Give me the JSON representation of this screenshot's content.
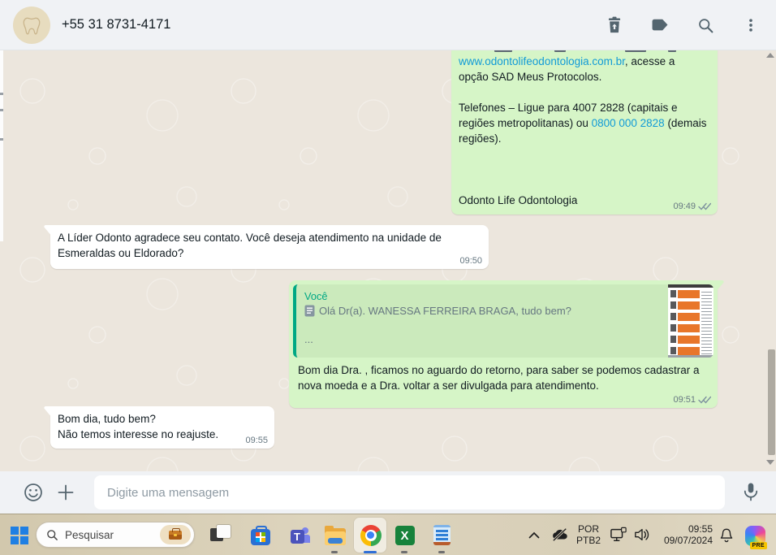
{
  "header": {
    "title": "+55 31 8731-4171"
  },
  "chat": {
    "messages": [
      {
        "direction": "out",
        "time": "09:49",
        "status": "delivered",
        "segments": [
          {
            "text": "www.odontolifeodontologia.com.br",
            "link": true
          },
          {
            "text": ", acesse a\nopção SAD Meus Protocolos.\n\nTelefones – Ligue para 4007 2828 (capitais e\nregiões metropolitanas) ou ",
            "link": false
          },
          {
            "text": "0800 000 2828",
            "link": true
          },
          {
            "text": " (demais\nregiões).\n\n\n\nOdonto Life Odontologia",
            "link": false
          }
        ]
      },
      {
        "direction": "in",
        "time": "09:50",
        "text": "A Líder Odonto agradece seu contato. Você deseja atendimento na unidade de\nEsmeraldas ou Eldorado?"
      },
      {
        "direction": "out",
        "time": "09:51",
        "status": "delivered",
        "quote": {
          "author": "Você",
          "text": "Olá Dr(a). WANESSA FERREIRA BRAGA, tudo bem?",
          "more": "...",
          "attachment": "document-thumbnail"
        },
        "text": "Bom dia Dra. , ficamos no aguardo do retorno, para saber se podemos cadastrar a\nnova moeda e a Dra. voltar a ser divulgada para atendimento."
      },
      {
        "direction": "in",
        "time": "09:55",
        "text": "Bom dia, tudo bem?\nNão temos interesse no reajuste."
      }
    ]
  },
  "composer": {
    "placeholder": "Digite uma mensagem"
  },
  "taskbar": {
    "search_placeholder": "Pesquisar",
    "teams_letter": "T",
    "tray": {
      "language_top": "POR",
      "language_bottom": "PTB2",
      "time": "09:55",
      "date": "09/07/2024",
      "copilot_badge": "PRE"
    }
  },
  "colors": {
    "header_bg": "#f0f2f5",
    "wallpaper": "#ece6dd",
    "outgoing_bubble": "#d6f5c7",
    "incoming_bubble": "#ffffff",
    "link_blue": "#119bd7",
    "quote_accent": "#00a884",
    "icon_gray": "#54656f",
    "taskbar_beige": "#d6ccb3"
  }
}
